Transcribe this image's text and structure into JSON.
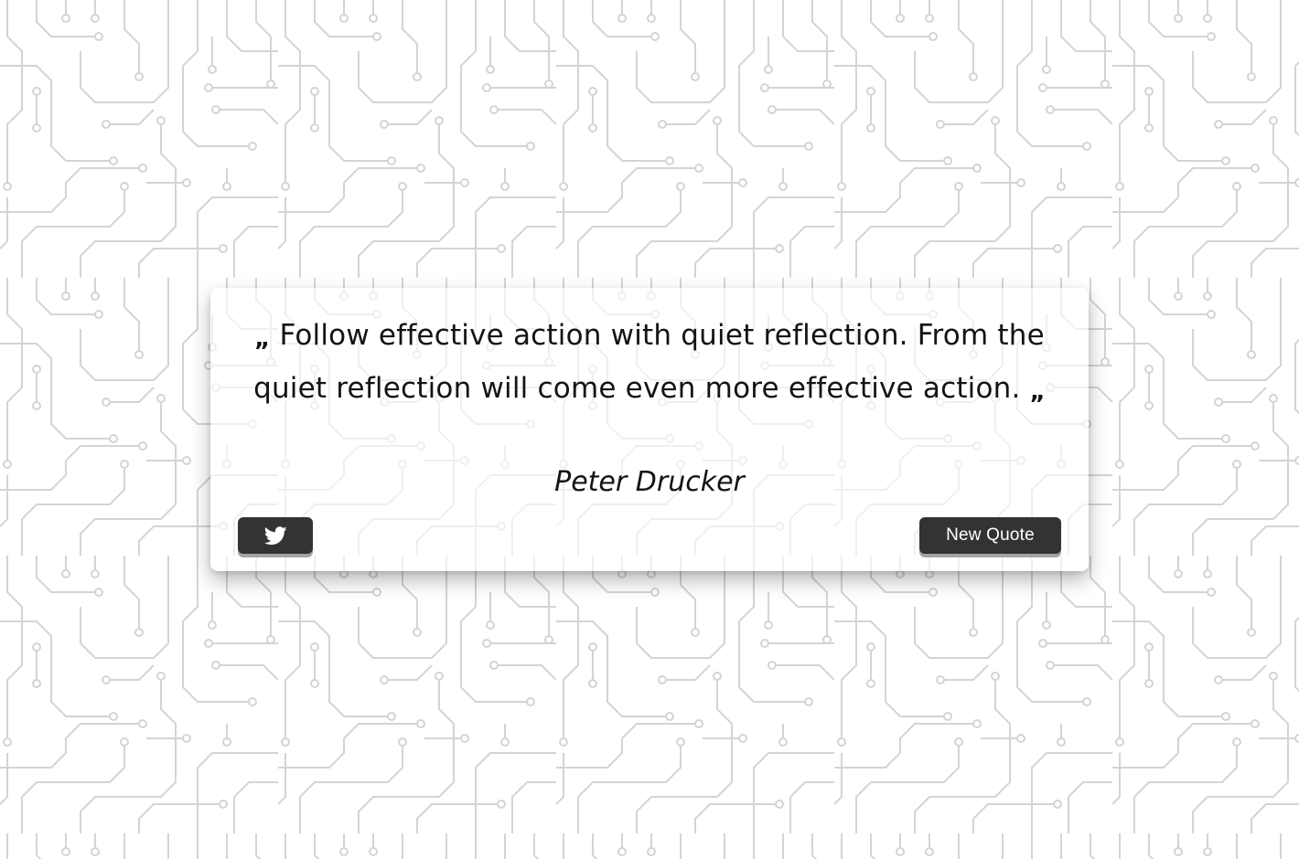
{
  "quote": {
    "open_mark": "„",
    "text": "Follow effective action with quiet reflection. From the quiet reflection will come even more effective action.",
    "close_mark": "„",
    "author": "Peter Drucker"
  },
  "buttons": {
    "tweet_icon": "twitter-bird-icon",
    "new_quote_label": "New Quote"
  },
  "colors": {
    "button_bg": "#333333",
    "button_text": "#ffffff",
    "text": "#141414",
    "background": "#ffffff",
    "circuit_lines": "#d9d9d9"
  },
  "background": {
    "pattern": "circuit-board"
  }
}
